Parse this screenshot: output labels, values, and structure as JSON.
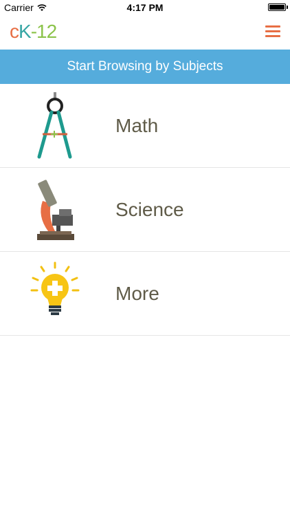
{
  "status_bar": {
    "carrier": "Carrier",
    "time": "4:17 PM",
    "wifi_icon": "wifi-icon",
    "battery_level": 1.0
  },
  "header": {
    "logo": {
      "c": "c",
      "k": "K",
      "rest": "-12"
    },
    "menu_icon": "hamburger-menu-icon",
    "accent_color": "#e76e44"
  },
  "banner": {
    "title": "Start Browsing by Subjects",
    "color": "#55acdc"
  },
  "subjects": [
    {
      "label": "Math",
      "icon": "compass-icon"
    },
    {
      "label": "Science",
      "icon": "microscope-icon"
    },
    {
      "label": "More",
      "icon": "lightbulb-icon"
    }
  ]
}
